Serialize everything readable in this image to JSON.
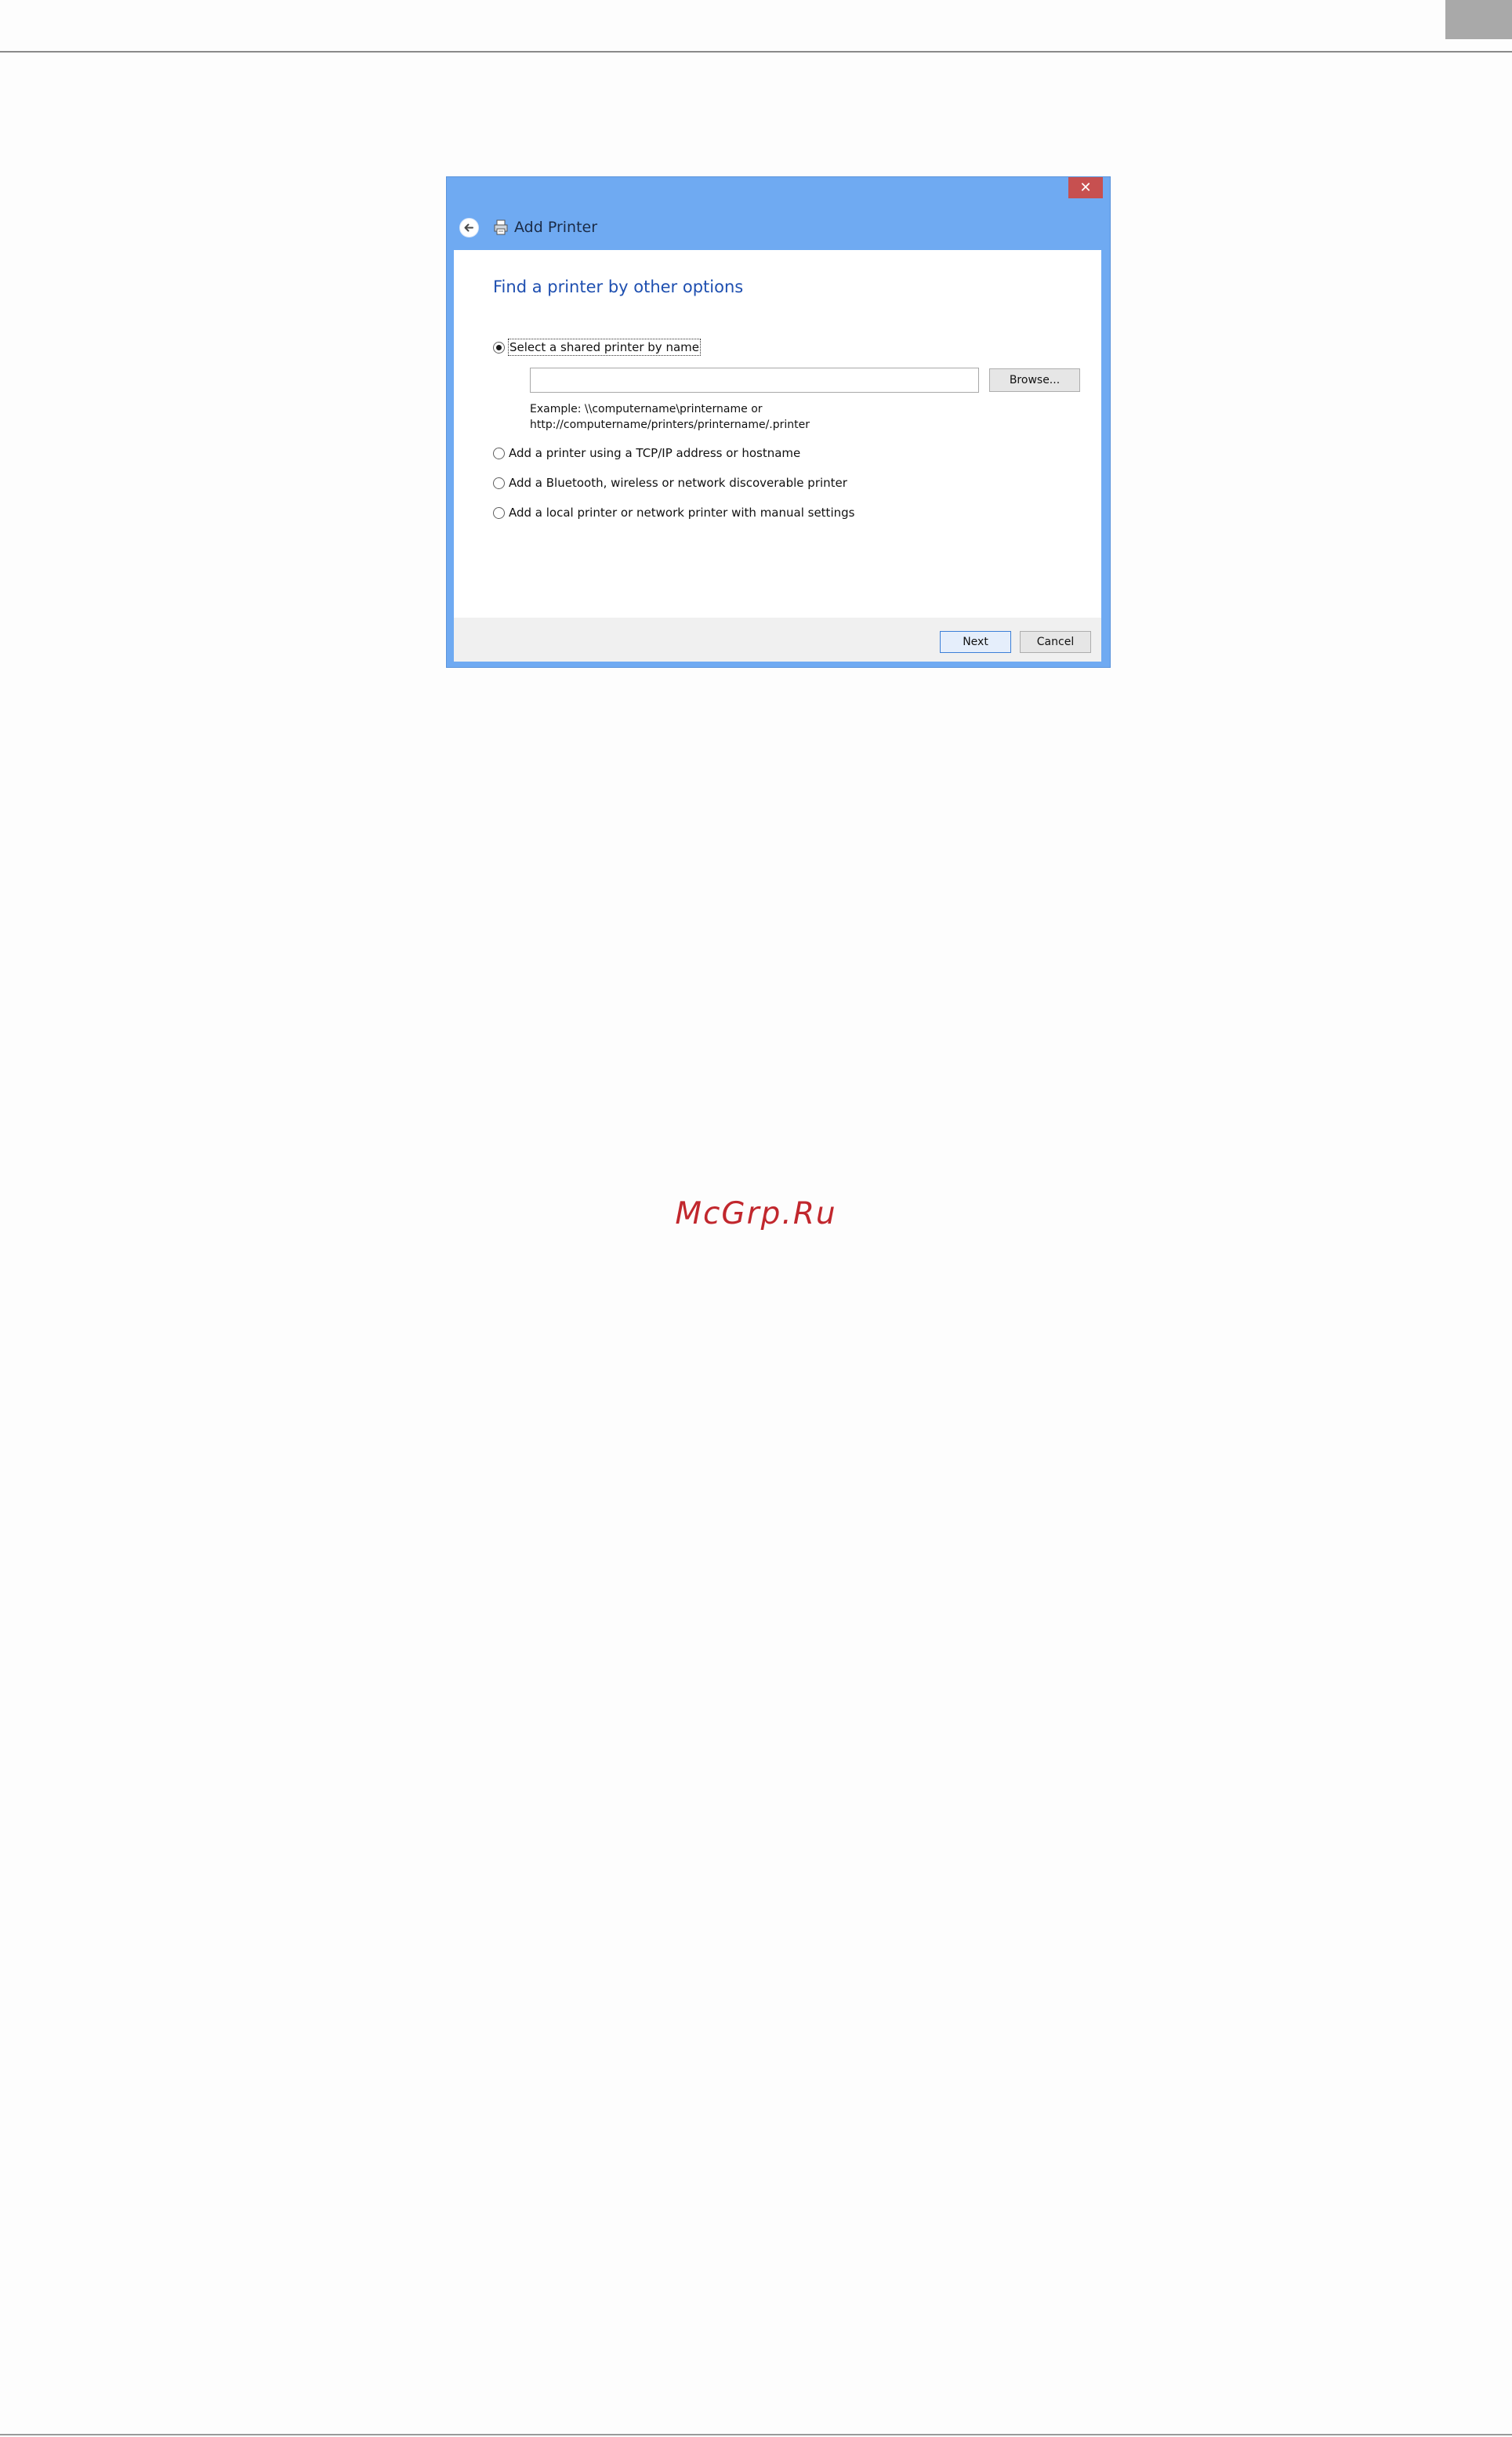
{
  "dialog": {
    "title": "Add Printer",
    "close_glyph": "✕",
    "heading": "Find a printer by other options",
    "options": [
      {
        "label": "Select a shared printer by name",
        "selected": true
      },
      {
        "label": "Add a printer using a TCP/IP address or hostname",
        "selected": false
      },
      {
        "label": "Add a Bluetooth, wireless or network discoverable printer",
        "selected": false
      },
      {
        "label": "Add a local printer or network printer with manual settings",
        "selected": false
      }
    ],
    "printer_name_value": "",
    "browse_label": "Browse...",
    "example_line1": "Example: \\\\computername\\printername or",
    "example_line2": "http://computername/printers/printername/.printer",
    "next_label": "Next",
    "cancel_label": "Cancel"
  },
  "watermark": "McGrp.Ru",
  "icons": [
    "back-arrow-icon",
    "printer-icon",
    "close-icon"
  ],
  "colors": {
    "title_bar": "#6faaf2",
    "close_button": "#c75050",
    "heading": "#1e4fb0",
    "watermark": "#c1272d"
  }
}
